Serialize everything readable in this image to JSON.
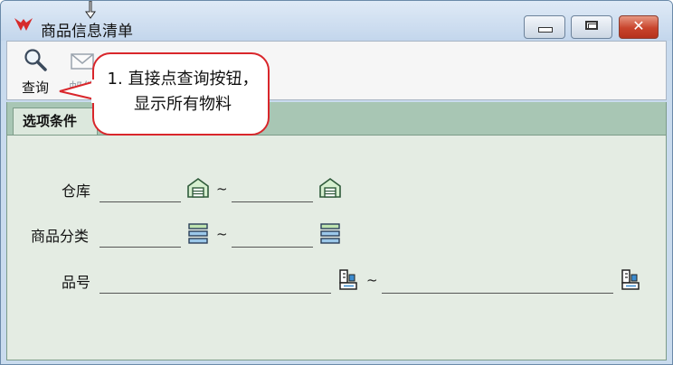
{
  "window": {
    "title": "商品信息清单",
    "close_glyph": "✕"
  },
  "toolbar": {
    "query_label": "查询",
    "second_label": "邮件"
  },
  "tab": {
    "label": "选项条件"
  },
  "callout": {
    "text": "1. 直接点查询按钮，显示所有物料"
  },
  "form": {
    "warehouse_label": "仓库",
    "category_label": "商品分类",
    "item_no_label": "品号",
    "range_separator": "~"
  },
  "icons": {
    "app": "red-check-logo-icon",
    "query": "magnifier-icon",
    "mail": "envelope-icon",
    "warehouse": "warehouse-icon",
    "category": "list-icon",
    "item": "item-lookup-icon"
  },
  "colors": {
    "callout_border": "#d9262b",
    "tab_strip": "#a8c6b4",
    "panel": "#e4ece3"
  }
}
